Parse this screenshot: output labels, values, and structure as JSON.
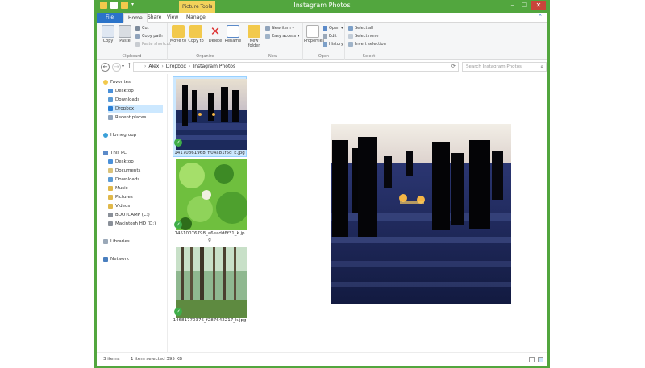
{
  "window": {
    "title": "Instagram Photos",
    "contextual_tab_group": "Picture Tools",
    "controls": {
      "minimize": "–",
      "maximize": "☐",
      "close": "✕"
    }
  },
  "ribbon_tabs": [
    "File",
    "Home",
    "Share",
    "View",
    "Manage"
  ],
  "ribbon": {
    "clipboard": {
      "label": "Clipboard",
      "copy": "Copy",
      "paste": "Paste",
      "cut": "Cut",
      "copy_path": "Copy path",
      "paste_shortcut": "Paste shortcut"
    },
    "organize": {
      "label": "Organize",
      "move_to": "Move to",
      "copy_to": "Copy to",
      "delete": "Delete",
      "rename": "Rename"
    },
    "new": {
      "label": "New",
      "new_folder": "New folder",
      "new_item": "New item",
      "easy_access": "Easy access"
    },
    "open": {
      "label": "Open",
      "properties": "Properties",
      "open": "Open",
      "edit": "Edit",
      "history": "History"
    },
    "select": {
      "label": "Select",
      "select_all": "Select all",
      "select_none": "Select none",
      "invert_selection": "Invert selection"
    }
  },
  "address": {
    "path": [
      "Alex",
      "Dropbox",
      "Instagram Photos"
    ],
    "search_placeholder": "Search Instagram Photos"
  },
  "nav": {
    "favorites": "Favorites",
    "favorites_items": [
      "Desktop",
      "Downloads",
      "Dropbox",
      "Recent places"
    ],
    "homegroup": "Homegroup",
    "this_pc": "This PC",
    "pc_items": [
      "Desktop",
      "Documents",
      "Downloads",
      "Music",
      "Pictures",
      "Videos",
      "BOOTCAMP (C:)",
      "Macintosh HD (D:)"
    ],
    "libraries": "Libraries",
    "network": "Network"
  },
  "files": [
    {
      "line1": "14170861968_ff04a81f5d_k.jpg",
      "line2": "",
      "selected": true
    },
    {
      "line1": "14510076798_a6eadd6f31_k.jp",
      "line2": "g",
      "selected": false
    },
    {
      "line1": "14681770376_f287642217_k.jpg",
      "line2": "",
      "selected": false
    }
  ],
  "status": {
    "items": "3 items",
    "selection": "1 item selected  395 KB"
  },
  "colors": {
    "title_bar": "#52a63e",
    "file_tab": "#2b73c9",
    "picture_tools": "#f2d25a",
    "selection": "#cce8ff",
    "sync_check": "#3fae49"
  }
}
